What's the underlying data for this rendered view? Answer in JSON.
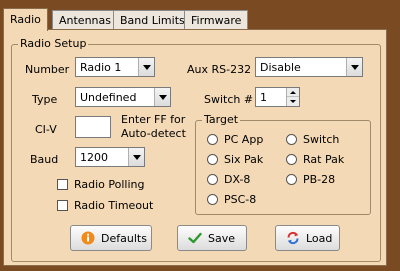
{
  "tabs": [
    {
      "label": "Radio",
      "active": true
    },
    {
      "label": "Antennas",
      "active": false
    },
    {
      "label": "Band Limits",
      "active": false
    },
    {
      "label": "Firmware",
      "active": false
    }
  ],
  "radio_setup": {
    "title": "Radio Setup",
    "number": {
      "label": "Number",
      "value": "Radio 1"
    },
    "aux": {
      "label": "Aux RS-232",
      "value": "Disable"
    },
    "type": {
      "label": "Type",
      "value": "Undefined"
    },
    "switch": {
      "label": "Switch #",
      "value": "1"
    },
    "civ": {
      "label": "CI-V",
      "value": "",
      "hint_line1": "Enter FF for",
      "hint_line2": "Auto-detect"
    },
    "baud": {
      "label": "Baud",
      "value": "1200"
    },
    "radio_polling": {
      "label": "Radio Polling",
      "checked": false
    },
    "radio_timeout": {
      "label": "Radio Timeout",
      "checked": false
    }
  },
  "target": {
    "title": "Target",
    "options": [
      "PC App",
      "Switch",
      "Six Pak",
      "Rat Pak",
      "DX-8",
      "PB-28",
      "PSC-8"
    ]
  },
  "buttons": {
    "defaults": "Defaults",
    "save": "Save",
    "load": "Load"
  },
  "colors": {
    "background": "#7a4a22",
    "panel": "#f3d9b5",
    "info_icon": "#f08a1c",
    "save_check": "#2e9a2e",
    "load_arrow_red": "#d83030",
    "load_arrow_blue": "#2f6fd6"
  }
}
